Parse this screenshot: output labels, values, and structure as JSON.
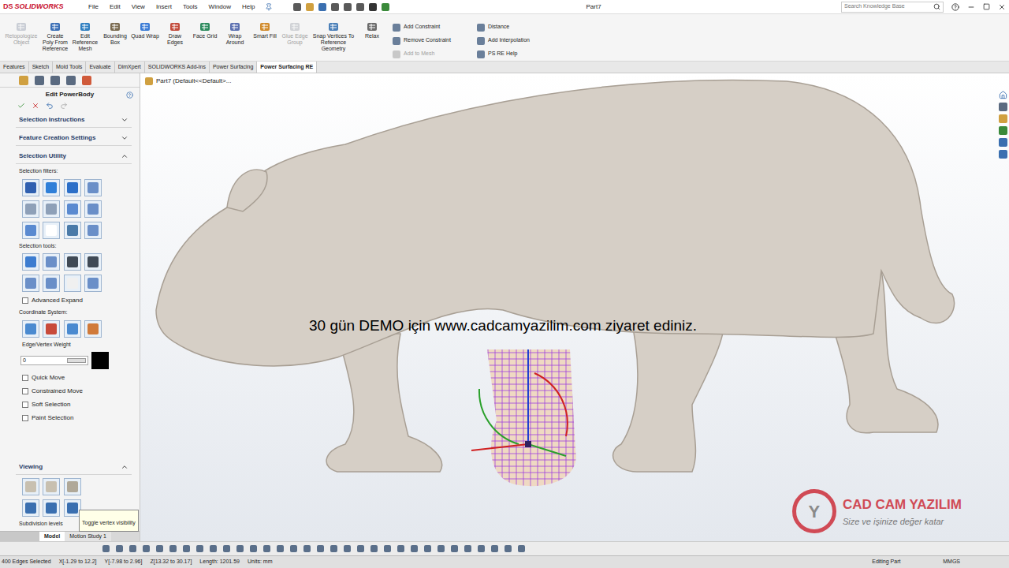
{
  "app": {
    "logo_prefix": "DS",
    "logo": "SOLIDWORKS",
    "menus": [
      "File",
      "Edit",
      "View",
      "Insert",
      "Tools",
      "Window",
      "Help"
    ],
    "title": "Part7",
    "search": {
      "placeholder": "Search Knowledge Base"
    }
  },
  "ribbon": {
    "tools": [
      {
        "label": "Retopologize Object",
        "disabled": true
      },
      {
        "label": "Create Poly From Reference",
        "disabled": false
      },
      {
        "label": "Edit Reference Mesh",
        "disabled": false
      },
      {
        "label": "Bounding Box",
        "disabled": false
      },
      {
        "label": "Quad Wrap",
        "disabled": false
      },
      {
        "label": "Draw Edges",
        "disabled": false
      },
      {
        "label": "Face Grid",
        "disabled": false
      },
      {
        "label": "Wrap Around",
        "disabled": false
      },
      {
        "label": "Smart Fill",
        "disabled": false
      },
      {
        "label": "Glue Edge Group",
        "disabled": true
      },
      {
        "label": "Snap Vertices To Reference Geometry",
        "disabled": false
      },
      {
        "label": "Relax",
        "disabled": false
      }
    ],
    "commands": [
      {
        "label": "Add Constraint",
        "disabled": false
      },
      {
        "label": "Remove Constraint",
        "disabled": false
      },
      {
        "label": "Add to Mesh",
        "disabled": true
      },
      {
        "label": "Distance",
        "disabled": false
      },
      {
        "label": "Add Interpolation",
        "disabled": false
      },
      {
        "label": "PS RE Help",
        "disabled": false
      }
    ]
  },
  "tabs": [
    {
      "label": "Features",
      "selected": false
    },
    {
      "label": "Sketch",
      "selected": false
    },
    {
      "label": "Mold Tools",
      "selected": false
    },
    {
      "label": "Evaluate",
      "selected": false
    },
    {
      "label": "DimXpert",
      "selected": false
    },
    {
      "label": "SOLIDWORKS Add-Ins",
      "selected": false
    },
    {
      "label": "Power Surfacing",
      "selected": false
    },
    {
      "label": "Power Surfacing RE",
      "selected": true
    }
  ],
  "tree": {
    "label": "Part7 (Default<<Default>..."
  },
  "property_manager": {
    "title": "Edit PowerBody",
    "sections": [
      {
        "label": "Selection Instructions",
        "expanded": false
      },
      {
        "label": "Feature Creation Settings",
        "expanded": false
      },
      {
        "label": "Selection Utility",
        "expanded": true
      }
    ],
    "filters_label": "Selection filters:",
    "tools_label": "Selection tools:",
    "advanced_expand": {
      "label": "Advanced Expand",
      "checked": false
    },
    "coordinate_label": "Coordinate System:",
    "weight": {
      "label": "Edge/Vertex Weight",
      "value": "0",
      "level": 0
    },
    "options": [
      {
        "label": "Quick Move",
        "checked": false
      },
      {
        "label": "Constrained Move",
        "checked": false
      },
      {
        "label": "Soft Selection",
        "checked": false
      },
      {
        "label": "Paint Selection",
        "checked": false
      }
    ],
    "viewing": {
      "label": "Viewing",
      "expanded": true
    },
    "subdivision_label": "Subdivision levels",
    "tooltip": "Toggle vertex visibility"
  },
  "bottom_tabs": [
    {
      "label": "Model",
      "selected": true
    },
    {
      "label": "Motion Study 1",
      "selected": false
    }
  ],
  "status_bar": {
    "items": [
      "400 Edges Selected",
      "X[-1.29 to 12.2]",
      "Y[-7.98 to 2.96]",
      "Z[13.32 to 30.17]",
      "Length: 1201.59",
      "Units: mm"
    ],
    "mode": "Editing Part",
    "units": "MMGS"
  },
  "overlay": {
    "watermark": "30 gün DEMO için www.cadcamyazilim.com ziyaret ediniz.",
    "brand": {
      "mark": "Y",
      "name": "CAD CAM YAZILIM",
      "tagline": "Size ve işinize değer katar"
    }
  }
}
